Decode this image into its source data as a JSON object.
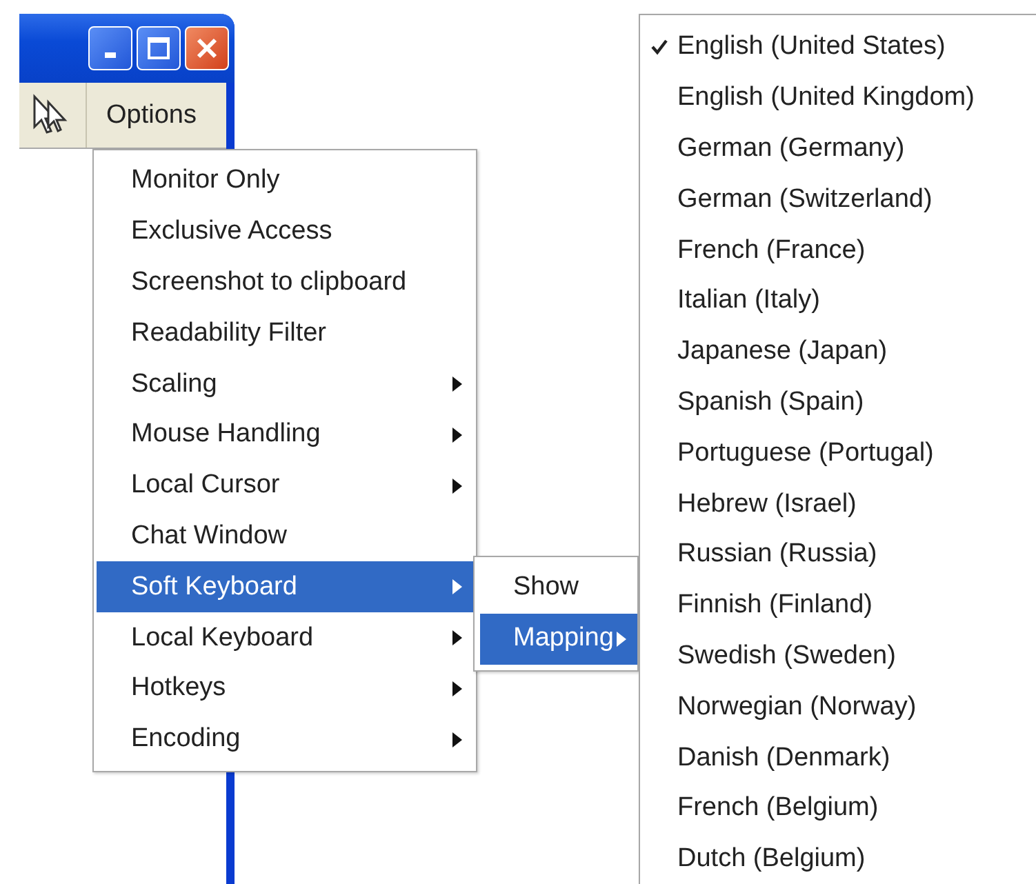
{
  "toolbar": {
    "options_button": "Options"
  },
  "options_menu": [
    {
      "label": "Monitor Only",
      "submenu": false,
      "selected": false
    },
    {
      "label": "Exclusive Access",
      "submenu": false,
      "selected": false
    },
    {
      "label": "Screenshot to clipboard",
      "submenu": false,
      "selected": false
    },
    {
      "label": "Readability Filter",
      "submenu": false,
      "selected": false
    },
    {
      "label": "Scaling",
      "submenu": true,
      "selected": false
    },
    {
      "label": "Mouse Handling",
      "submenu": true,
      "selected": false
    },
    {
      "label": "Local Cursor",
      "submenu": true,
      "selected": false
    },
    {
      "label": "Chat Window",
      "submenu": false,
      "selected": false
    },
    {
      "label": "Soft Keyboard",
      "submenu": true,
      "selected": true
    },
    {
      "label": "Local Keyboard",
      "submenu": true,
      "selected": false
    },
    {
      "label": "Hotkeys",
      "submenu": true,
      "selected": false
    },
    {
      "label": "Encoding",
      "submenu": true,
      "selected": false
    }
  ],
  "soft_keyboard_menu": [
    {
      "label": "Show",
      "submenu": false,
      "selected": false
    },
    {
      "label": "Mapping",
      "submenu": true,
      "selected": true
    }
  ],
  "mapping_menu": [
    {
      "label": "English (United States)",
      "checked": true
    },
    {
      "label": "English (United Kingdom)",
      "checked": false
    },
    {
      "label": "German (Germany)",
      "checked": false
    },
    {
      "label": "German (Switzerland)",
      "checked": false
    },
    {
      "label": "French (France)",
      "checked": false
    },
    {
      "label": "Italian (Italy)",
      "checked": false
    },
    {
      "label": "Japanese (Japan)",
      "checked": false
    },
    {
      "label": "Spanish (Spain)",
      "checked": false
    },
    {
      "label": "Portuguese (Portugal)",
      "checked": false
    },
    {
      "label": "Hebrew (Israel)",
      "checked": false
    },
    {
      "label": "Russian (Russia)",
      "checked": false
    },
    {
      "label": "Finnish (Finland)",
      "checked": false
    },
    {
      "label": "Swedish (Sweden)",
      "checked": false
    },
    {
      "label": "Norwegian (Norway)",
      "checked": false
    },
    {
      "label": "Danish (Denmark)",
      "checked": false
    },
    {
      "label": "French (Belgium)",
      "checked": false
    },
    {
      "label": "Dutch (Belgium)",
      "checked": false
    }
  ]
}
